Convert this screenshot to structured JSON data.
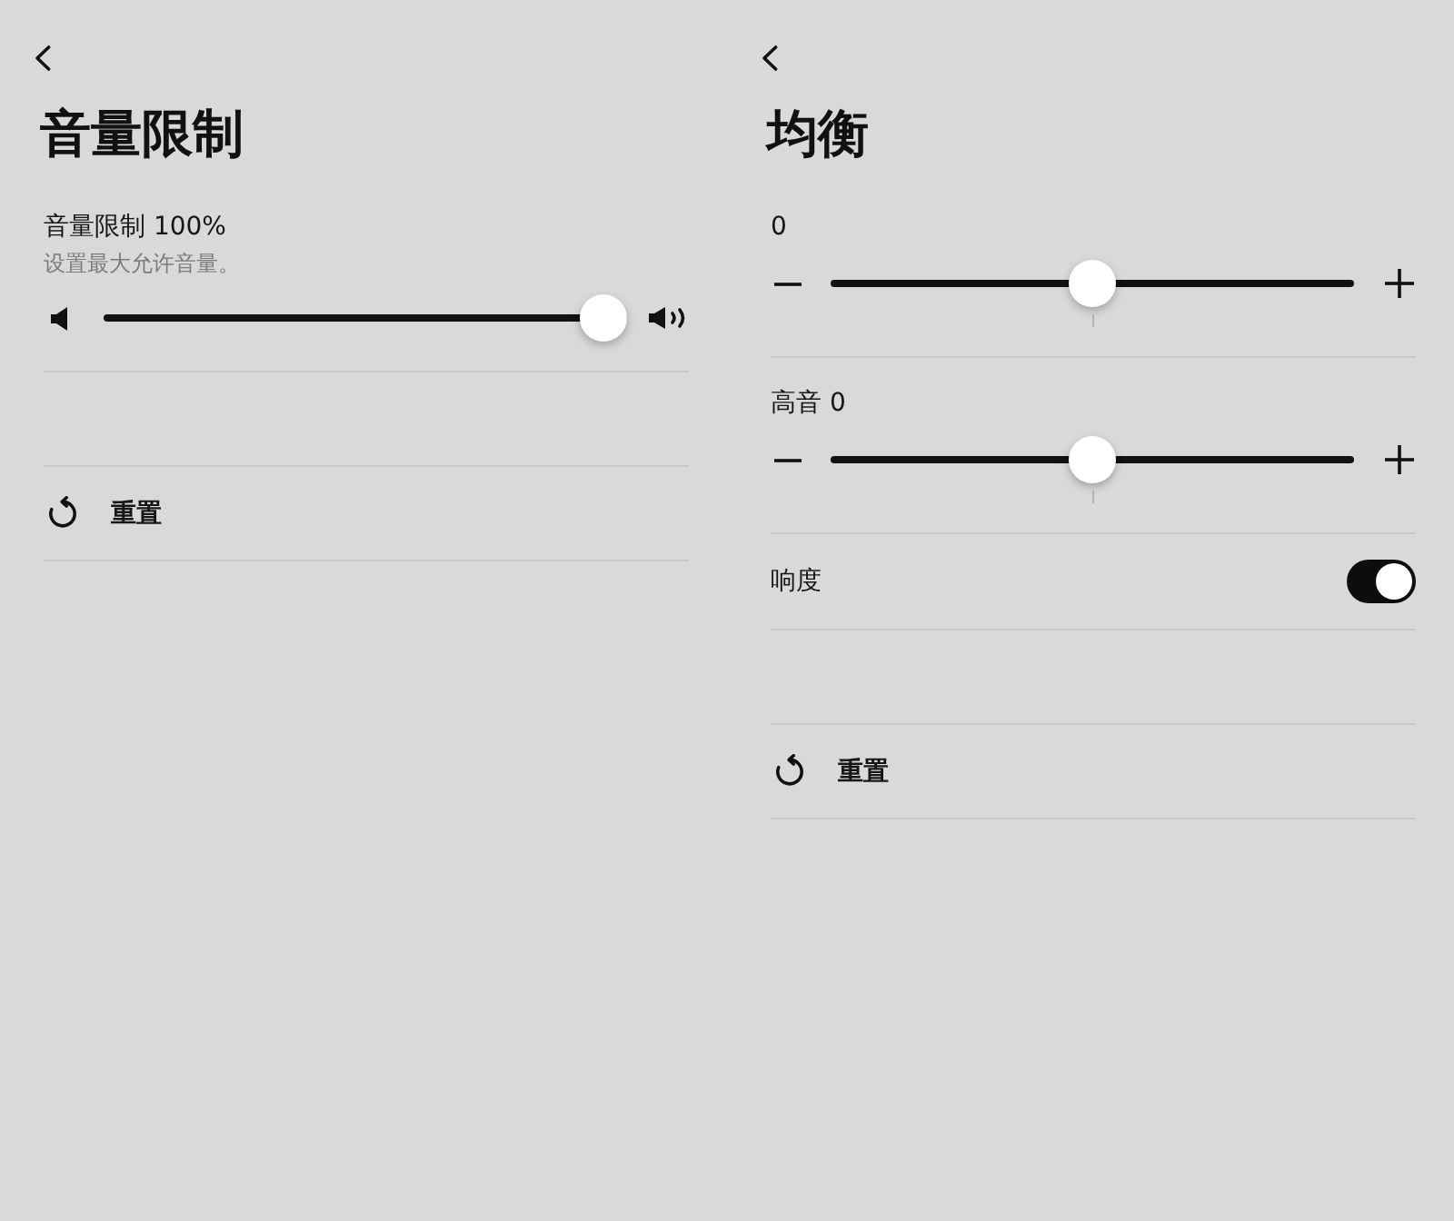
{
  "panels": [
    {
      "title": "音量限制",
      "rows": [
        {
          "kind": "volume",
          "label": "音量限制 100%",
          "description": "设置最大允许音量。",
          "level": 1
        },
        {
          "kind": "blank"
        },
        {
          "kind": "reset",
          "label": "重置"
        }
      ]
    },
    {
      "title": "均衡",
      "rows": [
        {
          "kind": "stepper",
          "label": "0",
          "level": 0.5,
          "center_mark": true
        },
        {
          "kind": "stepper",
          "label": "高音 0",
          "level": 0.5,
          "center_mark": true
        },
        {
          "kind": "toggle",
          "label": "响度",
          "on": true
        },
        {
          "kind": "blank"
        },
        {
          "kind": "reset",
          "label": "重置"
        }
      ]
    }
  ]
}
